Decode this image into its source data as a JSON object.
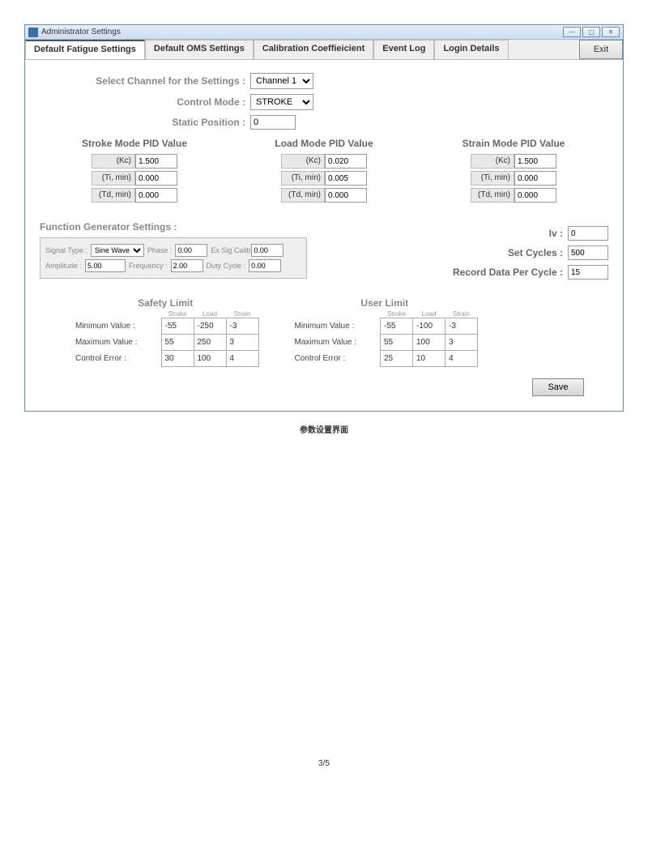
{
  "window": {
    "title": "Administrator Settings"
  },
  "tabs": {
    "t1": "Default Fatigue Settings",
    "t2": "Default OMS Settings",
    "t3": "Calibration Coeffieicient",
    "t4": "Event Log",
    "t5": "Login Details",
    "exit": "Exit"
  },
  "top": {
    "channel_lbl": "Select Channel for the Settings  :",
    "channel_val": "Channel 1",
    "mode_lbl": "Control Mode  :",
    "mode_val": "STROKE",
    "static_lbl": "Static Position  :",
    "static_val": "0"
  },
  "pid": {
    "stroke_title": "Stroke Mode PID Value",
    "load_title": "Load Mode PID Value",
    "strain_title": "Strain Mode PID Value",
    "kc": "(Kc)",
    "ti": "(Ti, min)",
    "td": "(Td, min)",
    "stroke": {
      "kc": "1.500",
      "ti": "0.000",
      "td": "0.000"
    },
    "load": {
      "kc": "0.020",
      "ti": "0.005",
      "td": "0.000"
    },
    "strain": {
      "kc": "1.500",
      "ti": "0.000",
      "td": "0.000"
    }
  },
  "fgen": {
    "title": "Function Generator Settings  :",
    "sig_lbl": "Signal Type  :",
    "sig_val": "Sine Wave",
    "phase_lbl": "Phase  :",
    "phase_val": "0.00",
    "exsig_lbl": "Ex Sig Calib Coef.",
    "exsig_val": "0.00",
    "amp_lbl": "Amplitude  :",
    "amp_val": "5.00",
    "freq_lbl": "Frequency  :",
    "freq_val": "2.00",
    "duty_lbl": "Duty Cycle :",
    "duty_val": "0.00"
  },
  "right": {
    "iv_lbl": "Iv  :",
    "iv_val": "0",
    "cycles_lbl": "Set Cycles  :",
    "cycles_val": "500",
    "rec_lbl": "Record Data Per Cycle  :",
    "rec_val": "15"
  },
  "limits": {
    "safety_title": "Safety Limit",
    "user_title": "User Limit",
    "col_stroke": "Stroke",
    "col_load": "Load",
    "col_strain": "Strain",
    "min_lbl": "Minimum Value  :",
    "max_lbl": "Maximum Value  :",
    "err_lbl": "Control Error  :",
    "safety": {
      "min": [
        "-55",
        "-250",
        "-3"
      ],
      "max": [
        "55",
        "250",
        "3"
      ],
      "err": [
        "30",
        "100",
        "4"
      ]
    },
    "user": {
      "min": [
        "-55",
        "-100",
        "-3"
      ],
      "max": [
        "55",
        "100",
        "3"
      ],
      "err": [
        "25",
        "10",
        "4"
      ]
    }
  },
  "buttons": {
    "save": "Save"
  },
  "caption": "参数设置界面",
  "pagenum": "3/5"
}
